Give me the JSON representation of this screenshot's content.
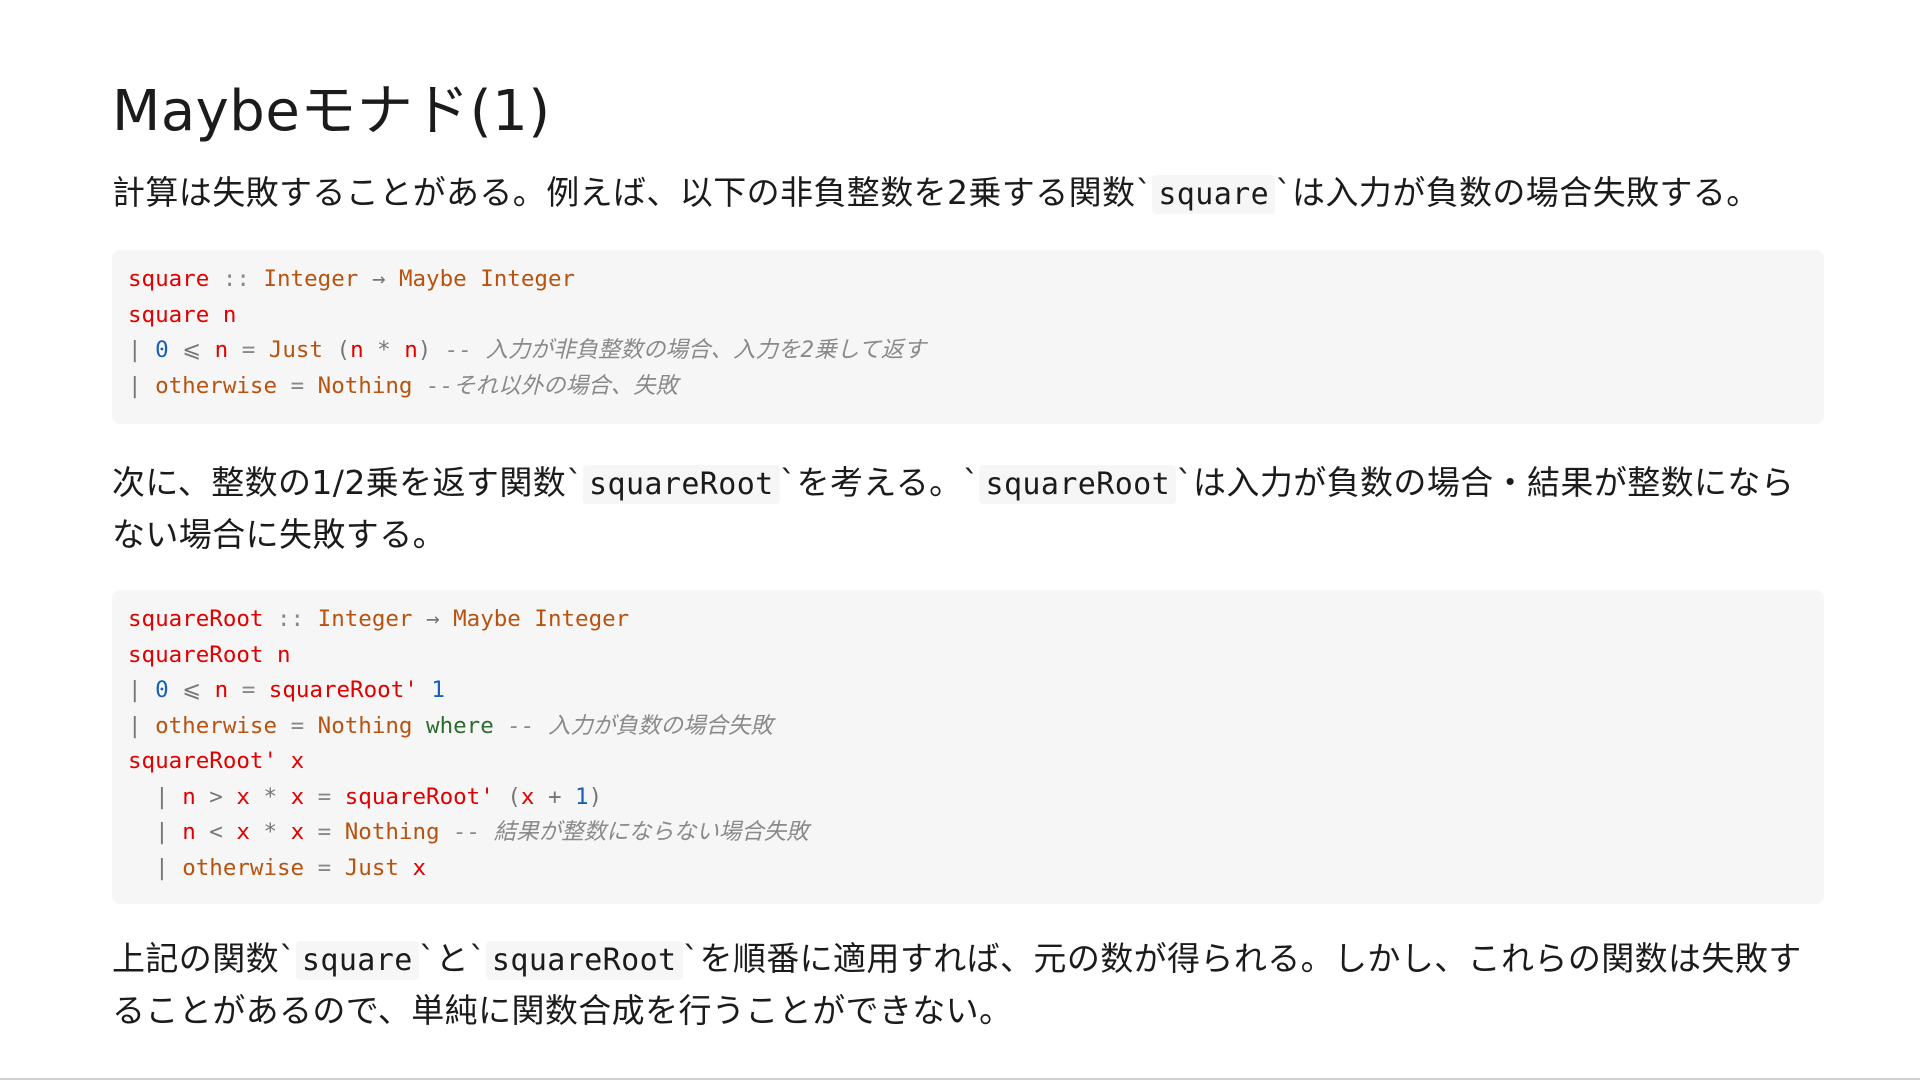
{
  "slide": {
    "title": "Maybeモナド(1)",
    "para1": {
      "before": "計算は失敗することがある。例えば、以下の非負整数を2乗する関数",
      "code": "square",
      "after": "は入力が負数の場合失敗する。"
    },
    "code_block_1": {
      "line1": {
        "name": "square",
        "sig": "::",
        "t1": "Integer",
        "arrow": "→",
        "t2": "Maybe",
        "t3": "Integer"
      },
      "line2": {
        "name": "square",
        "arg": "n"
      },
      "line3": {
        "bar": "|",
        "zero": "0",
        "le": "⩽",
        "n1": "n",
        "eq": "=",
        "just": "Just",
        "lp": "(",
        "n2": "n",
        "mul": "*",
        "n3": "n",
        "rp": ")",
        "comment": "-- 入力が非負整数の場合、入力を2乗して返す"
      },
      "line4": {
        "bar": "|",
        "otherwise": "otherwise",
        "eq": "=",
        "nothing": "Nothing",
        "comment": "--それ以外の場合、失敗"
      }
    },
    "para2": {
      "before": "次に、整数の1/2乗を返す関数",
      "code1": "squareRoot",
      "middle": "を考える。",
      "code2": "squareRoot",
      "after": "は入力が負数の場合・結果が整数にならない場合に失敗する。"
    },
    "code_block_2": {
      "line1": {
        "name": "squareRoot",
        "sig": "::",
        "t1": "Integer",
        "arrow": "→",
        "t2": "Maybe",
        "t3": "Integer"
      },
      "line2": {
        "name": "squareRoot",
        "arg": "n"
      },
      "line3": {
        "bar": "|",
        "zero": "0",
        "le": "⩽",
        "n1": "n",
        "eq": "=",
        "call": "squareRoot'",
        "one": "1"
      },
      "line4": {
        "bar": "|",
        "otherwise": "otherwise",
        "eq": "=",
        "nothing": "Nothing",
        "where": "where",
        "comment": "-- 入力が負数の場合失敗"
      },
      "line5": {
        "name": "squareRoot'",
        "arg": "x"
      },
      "line6": {
        "bar": "|",
        "n": "n",
        "gt": ">",
        "x1": "x",
        "mul": "*",
        "x2": "x",
        "eq": "=",
        "call": "squareRoot'",
        "lp": "(",
        "x3": "x",
        "plus": "+",
        "one": "1",
        "rp": ")"
      },
      "line7": {
        "bar": "|",
        "n": "n",
        "lt": "<",
        "x1": "x",
        "mul": "*",
        "x2": "x",
        "eq": "=",
        "nothing": "Nothing",
        "comment": "-- 結果が整数にならない場合失敗"
      },
      "line8": {
        "bar": "|",
        "otherwise": "otherwise",
        "eq": "=",
        "just": "Just",
        "x": "x"
      }
    },
    "para3": {
      "before": "上記の関数",
      "code1": "square",
      "middle": "と",
      "code2": "squareRoot",
      "after": "を順番に適用すれば、元の数が得られる。しかし、これらの関数は失敗することがあるので、単純に関数合成を行うことができない。"
    }
  }
}
